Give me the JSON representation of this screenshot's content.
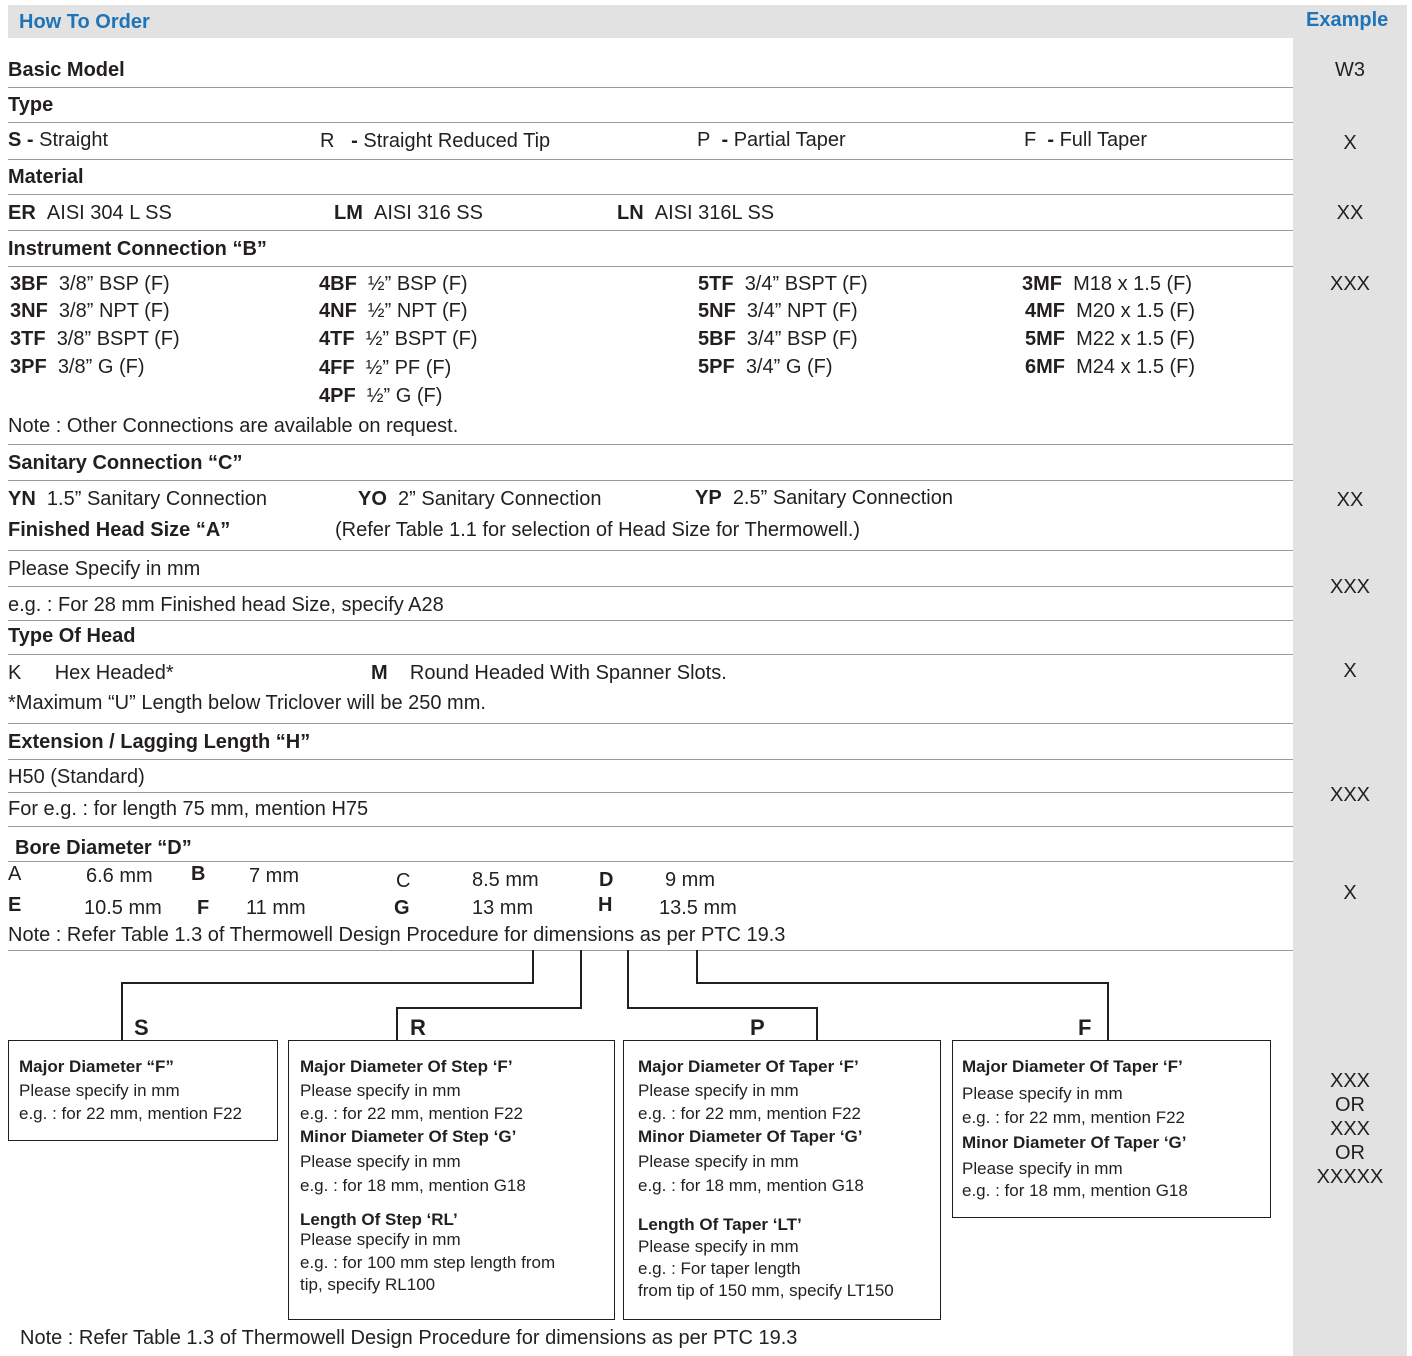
{
  "header": {
    "title": "How To Order",
    "example": "Example"
  },
  "basic_model": {
    "heading": "Basic Model",
    "example": "W3"
  },
  "type": {
    "heading": "Type",
    "options": [
      {
        "code": "S -",
        "label": "Straight"
      },
      {
        "code": "R",
        "dash": "-",
        "label": "Straight Reduced Tip"
      },
      {
        "code": "P",
        "dash": "-",
        "label": "Partial Taper"
      },
      {
        "code": "F",
        "dash": "-",
        "label": "Full Taper"
      }
    ],
    "example": "X"
  },
  "material": {
    "heading": "Material",
    "options": [
      {
        "code": "ER",
        "label": "AISI 304 L SS"
      },
      {
        "code": "LM",
        "label": "AISI 316 SS"
      },
      {
        "code": "LN",
        "label": "AISI 316L SS"
      }
    ],
    "example": "XX"
  },
  "instrument_connection": {
    "heading": "Instrument Connection “B”",
    "columns": [
      [
        {
          "code": "3BF",
          "label": "3/8” BSP (F)"
        },
        {
          "code": "3NF",
          "label": "3/8” NPT (F)"
        },
        {
          "code": "3TF",
          "label": "3/8” BSPT (F)"
        },
        {
          "code": "3PF",
          "label": "3/8” G (F)"
        }
      ],
      [
        {
          "code": "4BF",
          "label": "½” BSP (F)"
        },
        {
          "code": "4NF",
          "label": "½” NPT (F)"
        },
        {
          "code": "4TF",
          "label": "½” BSPT (F)"
        },
        {
          "code": "4FF",
          "label": "½” PF (F)"
        },
        {
          "code": "4PF",
          "label": "½” G (F)"
        }
      ],
      [
        {
          "code": "5TF",
          "label": "3/4” BSPT (F)"
        },
        {
          "code": "5NF",
          "label": "3/4” NPT (F)"
        },
        {
          "code": "5BF",
          "label": "3/4” BSP (F)"
        },
        {
          "code": "5PF",
          "label": "3/4” G (F)"
        }
      ],
      [
        {
          "code": "3MF",
          "label": "M18 x 1.5 (F)"
        },
        {
          "code": "4MF",
          "label": "M20 x 1.5 (F)"
        },
        {
          "code": "5MF",
          "label": "M22 x 1.5 (F)"
        },
        {
          "code": "6MF",
          "label": "M24 x 1.5 (F)"
        }
      ]
    ],
    "note": "Note : Other Connections are available on request.",
    "example": "XXX"
  },
  "sanitary_connection": {
    "heading": "Sanitary Connection “C”",
    "options": [
      {
        "code": "YN",
        "label": "1.5” Sanitary Connection"
      },
      {
        "code": "YO",
        "label": "2” Sanitary Connection"
      },
      {
        "code": "YP",
        "label": "2.5” Sanitary Connection"
      }
    ],
    "example": "XX"
  },
  "head_size": {
    "heading": "Finished Head Size “A”",
    "ref": "(Refer Table 1.1 for selection of Head Size for Thermowell.)",
    "line1": "Please Specify in mm",
    "line2": "e.g. : For 28 mm Finished head Size, specify A28",
    "example": "XXX"
  },
  "head_type": {
    "heading": "Type Of Head",
    "options": [
      {
        "code": "K",
        "label": "Hex Headed*"
      },
      {
        "code": "M",
        "label": "Round Headed With Spanner Slots."
      }
    ],
    "note": "*Maximum “U” Length below Triclover will be 250 mm.",
    "example": "X"
  },
  "extension": {
    "heading": "Extension / Lagging Length “H”",
    "line1": "H50 (Standard)",
    "line2": "For e.g. : for length 75 mm, mention H75",
    "example": "XXX"
  },
  "bore": {
    "heading": "Bore Diameter “D”",
    "row1": [
      {
        "code": "A",
        "label": "6.6 mm"
      },
      {
        "code": "B",
        "label": "7 mm"
      },
      {
        "code": "C",
        "label": "8.5 mm"
      },
      {
        "code": "D",
        "label": "9 mm"
      }
    ],
    "row2": [
      {
        "code": "E",
        "label": "10.5 mm"
      },
      {
        "code": "F",
        "label": "11 mm"
      },
      {
        "code": "G",
        "label": "13 mm"
      },
      {
        "code": "H",
        "label": "13.5 mm"
      }
    ],
    "note": "Note : Refer Table 1.3 of Thermowell Design Procedure for dimensions as per PTC 19.3",
    "example": "X"
  },
  "profiles": [
    {
      "tab": "S",
      "lines": [
        {
          "t": "Major Diameter “F”",
          "b": true
        },
        {
          "t": "Please specify in mm"
        },
        {
          "t": "e.g. : for 22 mm, mention F22"
        }
      ]
    },
    {
      "tab": "R",
      "lines": [
        {
          "t": "Major Diameter Of Step ‘F’",
          "b": true
        },
        {
          "t": "Please specify in mm"
        },
        {
          "t": "e.g. : for 22 mm, mention F22"
        },
        {
          "t": "Minor Diameter Of Step ‘G’",
          "b": true
        },
        {
          "t": "Please specify in mm"
        },
        {
          "t": "e.g. : for 18 mm, mention G18"
        },
        {
          "t": "Length Of Step ‘RL’",
          "b": true
        },
        {
          "t": "Please specify in mm"
        },
        {
          "t": "e.g. : for 100 mm step length from"
        },
        {
          "t": "tip,  specify RL100"
        }
      ]
    },
    {
      "tab": "P",
      "lines": [
        {
          "t": "Major Diameter Of Taper ‘F’",
          "b": true
        },
        {
          "t": "Please specify in mm"
        },
        {
          "t": "e.g. : for 22 mm, mention F22"
        },
        {
          "t": "Minor Diameter Of Taper ‘G’",
          "b": true
        },
        {
          "t": "Please specify in mm"
        },
        {
          "t": "e.g. : for 18 mm, mention G18"
        },
        {
          "t": "Length Of Taper ‘LT’",
          "b": true
        },
        {
          "t": "Please specify in mm"
        },
        {
          "t": "e.g. : For taper length"
        },
        {
          "t": "from tip of 150 mm, specify LT150"
        }
      ]
    },
    {
      "tab": "F",
      "lines": [
        {
          "t": "Major Diameter Of Taper ‘F’",
          "b": true
        },
        {
          "t": "Please specify in mm"
        },
        {
          "t": "e.g. : for 22 mm, mention F22"
        },
        {
          "t": "Minor Diameter Of Taper ‘G’",
          "b": true
        },
        {
          "t": "Please specify in mm"
        },
        {
          "t": "e.g. : for 18 mm, mention G18"
        }
      ]
    }
  ],
  "profile_example": [
    "XXX",
    "OR",
    "XXX",
    "OR",
    "XXXXX"
  ],
  "footer_note": "Note : Refer Table 1.3 of Thermowell Design Procedure for dimensions as per PTC 19.3"
}
